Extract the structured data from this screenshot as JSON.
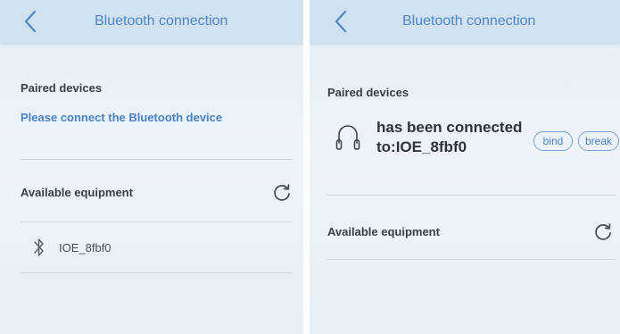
{
  "left_screen": {
    "header": {
      "back_icon": "chevron-left-icon",
      "title": "Bluetooth connection"
    },
    "paired_devices_label": "Paired devices",
    "paired_hint": "Please connect the Bluetooth device",
    "available_label": "Available equipment",
    "refresh_icon": "refresh-icon",
    "devices": [
      {
        "icon": "bluetooth-icon",
        "name": "IOE_8fbf0"
      }
    ]
  },
  "right_screen": {
    "header": {
      "back_icon": "chevron-left-icon",
      "title": "Bluetooth connection"
    },
    "paired_devices_label": "Paired devices",
    "connected_device": {
      "icon": "headphones-icon",
      "status_line1": "has been connected",
      "status_line2": "to:IOE_8fbf0",
      "bind_label": "bind",
      "break_label": "break"
    },
    "available_label": "Available equipment",
    "refresh_icon": "refresh-icon"
  },
  "colors": {
    "accent": "#4a82c4",
    "header_bg": "#d0e1ef",
    "text_dark": "#3a3f44"
  }
}
